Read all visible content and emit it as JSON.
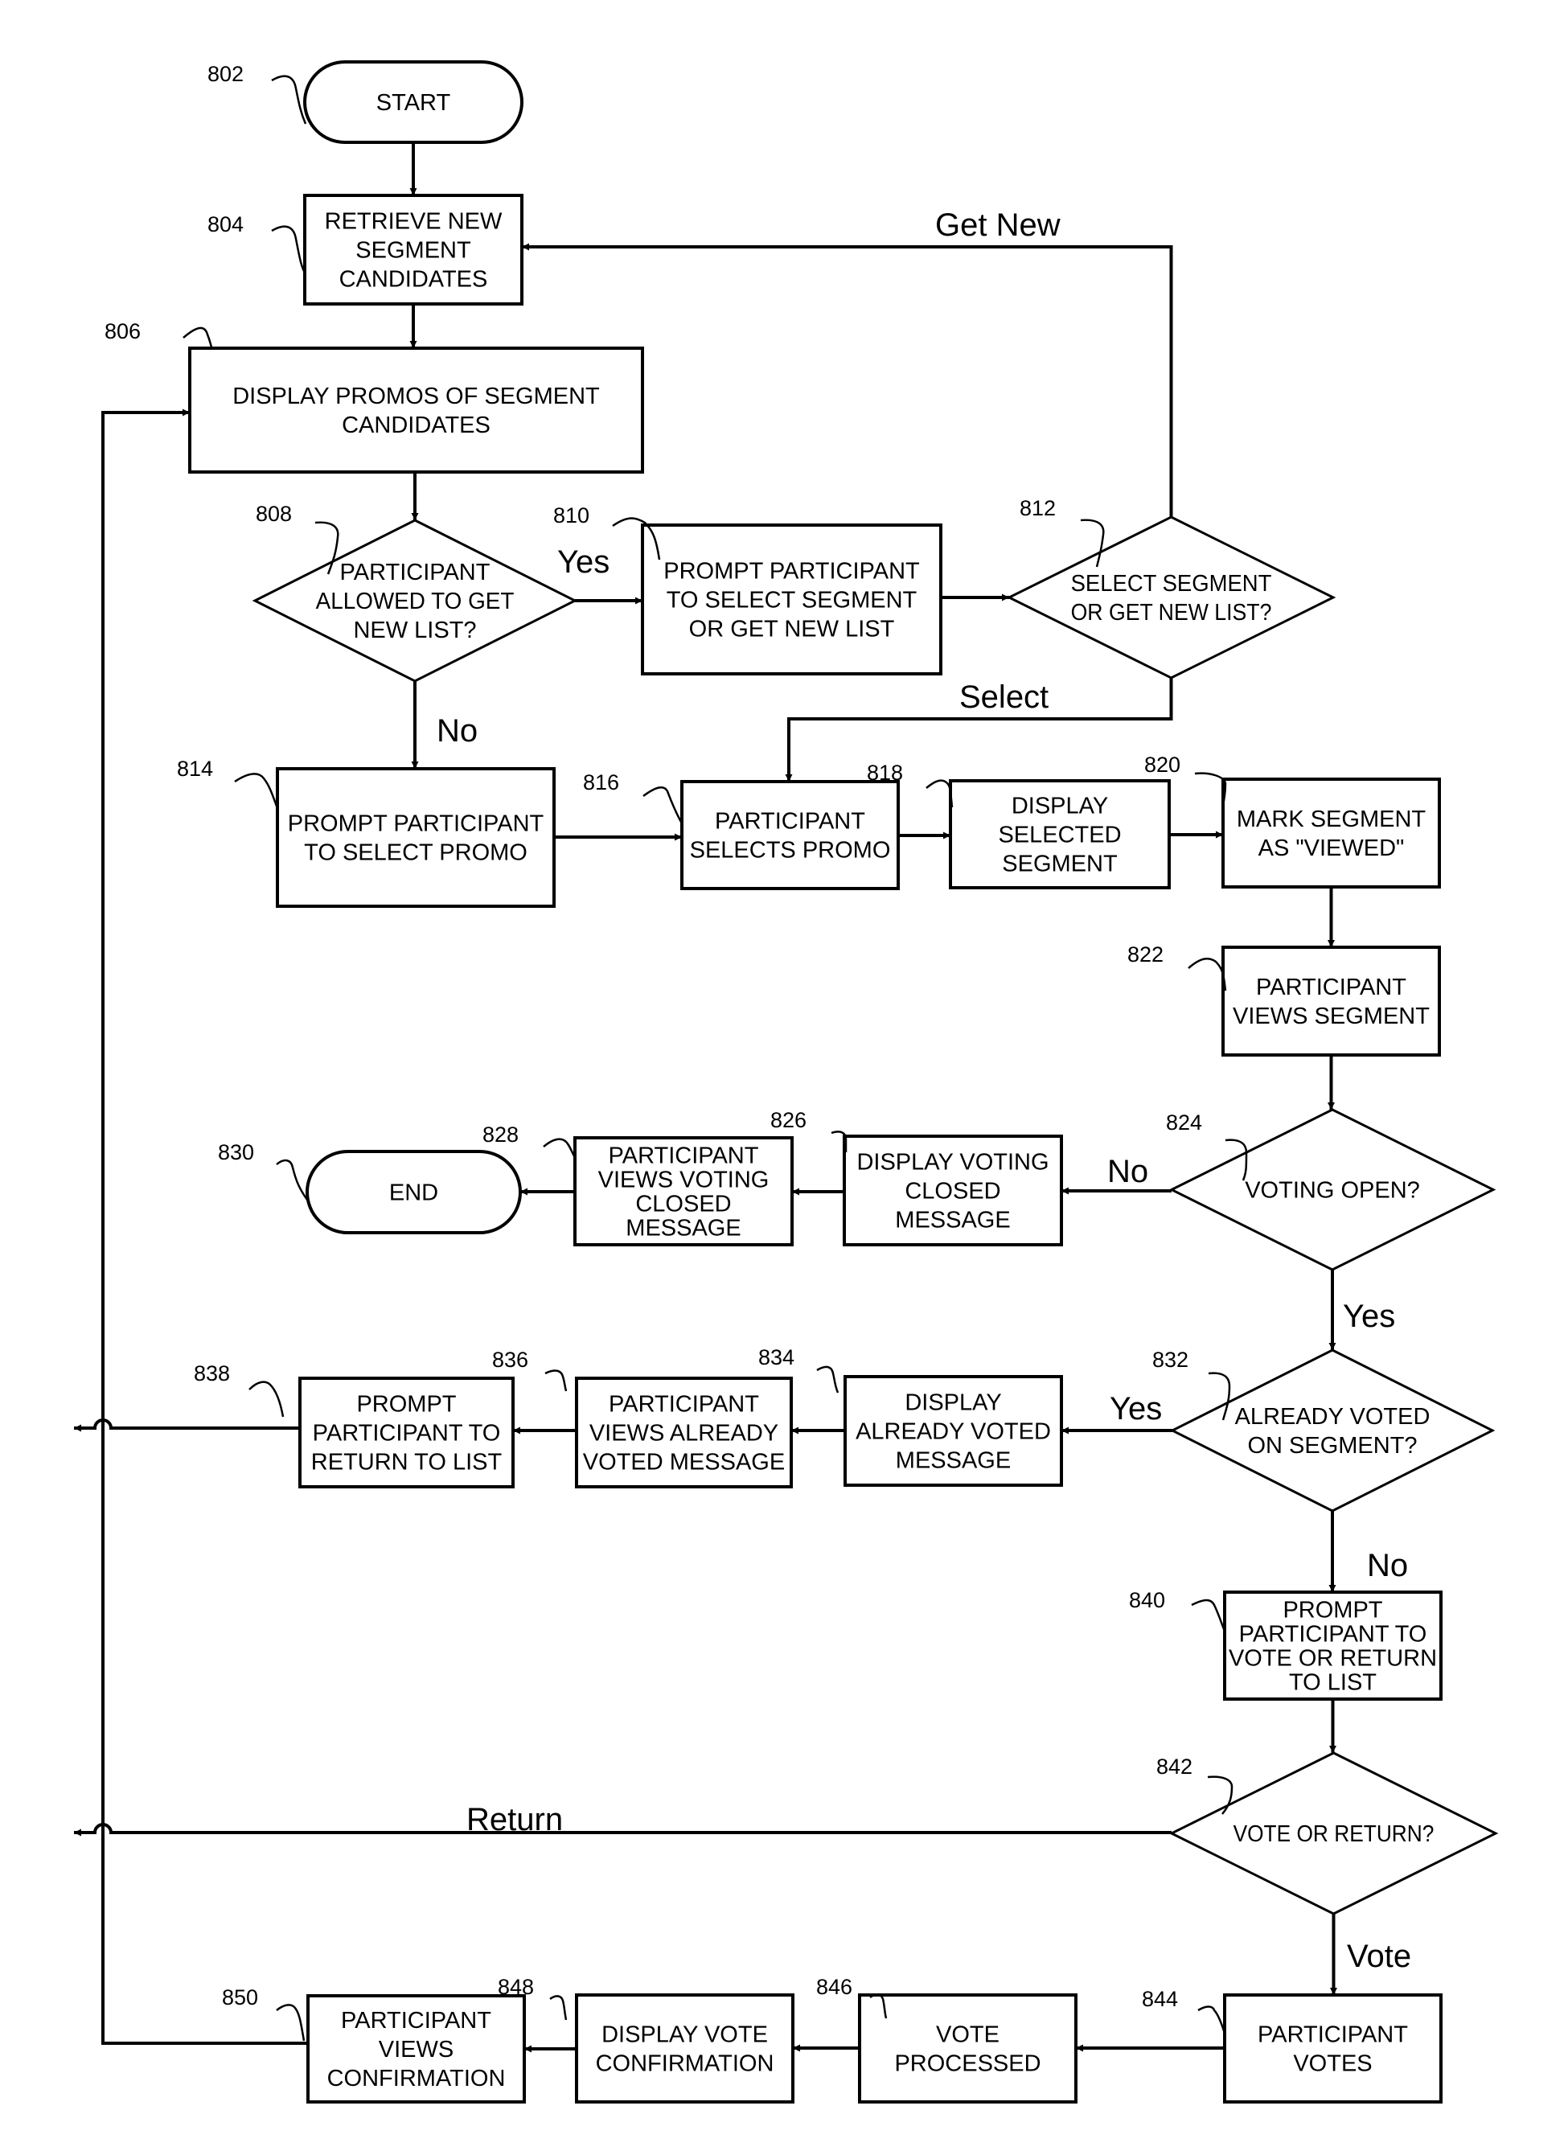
{
  "figure": {
    "type": "flowchart",
    "nodes": [
      {
        "id": "802",
        "ref": "802",
        "shape": "terminal",
        "lines": [
          "START"
        ]
      },
      {
        "id": "804",
        "ref": "804",
        "shape": "process",
        "lines": [
          "RETRIEVE NEW",
          "SEGMENT",
          "CANDIDATES"
        ]
      },
      {
        "id": "806",
        "ref": "806",
        "shape": "process",
        "lines": [
          "DISPLAY PROMOS OF SEGMENT",
          "CANDIDATES"
        ]
      },
      {
        "id": "808",
        "ref": "808",
        "shape": "decision",
        "lines": [
          "PARTICIPANT",
          "ALLOWED TO  GET",
          "NEW LIST?"
        ]
      },
      {
        "id": "810",
        "ref": "810",
        "shape": "process",
        "lines": [
          "PROMPT PARTICIPANT",
          "TO SELECT SEGMENT",
          "OR GET NEW LIST"
        ]
      },
      {
        "id": "812",
        "ref": "812",
        "shape": "decision",
        "lines": [
          "SELECT SEGMENT",
          "OR GET NEW LIST?"
        ]
      },
      {
        "id": "814",
        "ref": "814",
        "shape": "process",
        "lines": [
          "PROMPT PARTICIPANT",
          "TO SELECT PROMO"
        ]
      },
      {
        "id": "816",
        "ref": "816",
        "shape": "process",
        "lines": [
          "PARTICIPANT",
          "SELECTS PROMO"
        ]
      },
      {
        "id": "818",
        "ref": "818",
        "shape": "process",
        "lines": [
          "DISPLAY",
          "SELECTED",
          "SEGMENT"
        ]
      },
      {
        "id": "820",
        "ref": "820",
        "shape": "process",
        "lines": [
          "MARK SEGMENT",
          "AS \"VIEWED\""
        ]
      },
      {
        "id": "822",
        "ref": "822",
        "shape": "process",
        "lines": [
          "PARTICIPANT",
          "VIEWS SEGMENT"
        ]
      },
      {
        "id": "824",
        "ref": "824",
        "shape": "decision",
        "lines": [
          "VOTING OPEN?"
        ]
      },
      {
        "id": "826",
        "ref": "826",
        "shape": "process",
        "lines": [
          "DISPLAY VOTING",
          "CLOSED",
          "MESSAGE"
        ]
      },
      {
        "id": "828",
        "ref": "828",
        "shape": "process",
        "lines": [
          "PARTICIPANT",
          "VIEWS VOTING",
          "CLOSED",
          "MESSAGE"
        ]
      },
      {
        "id": "830",
        "ref": "830",
        "shape": "terminal",
        "lines": [
          "END"
        ]
      },
      {
        "id": "832",
        "ref": "832",
        "shape": "decision",
        "lines": [
          "ALREADY VOTED",
          "ON SEGMENT?"
        ]
      },
      {
        "id": "834",
        "ref": "834",
        "shape": "process",
        "lines": [
          "DISPLAY",
          "ALREADY VOTED",
          "MESSAGE"
        ]
      },
      {
        "id": "836",
        "ref": "836",
        "shape": "process",
        "lines": [
          "PARTICIPANT",
          "VIEWS ALREADY",
          "VOTED MESSAGE"
        ]
      },
      {
        "id": "838",
        "ref": "838",
        "shape": "process",
        "lines": [
          "PROMPT",
          "PARTICIPANT TO",
          "RETURN TO LIST"
        ]
      },
      {
        "id": "840",
        "ref": "840",
        "shape": "process",
        "lines": [
          "PROMPT",
          "PARTICIPANT TO",
          "VOTE OR RETURN",
          "TO LIST"
        ]
      },
      {
        "id": "842",
        "ref": "842",
        "shape": "decision",
        "lines": [
          "VOTE OR RETURN?"
        ]
      },
      {
        "id": "844",
        "ref": "844",
        "shape": "process",
        "lines": [
          "PARTICIPANT",
          "VOTES"
        ]
      },
      {
        "id": "846",
        "ref": "846",
        "shape": "process",
        "lines": [
          "VOTE",
          "PROCESSED"
        ]
      },
      {
        "id": "848",
        "ref": "848",
        "shape": "process",
        "lines": [
          "DISPLAY VOTE",
          "CONFIRMATION"
        ]
      },
      {
        "id": "850",
        "ref": "850",
        "shape": "process",
        "lines": [
          "PARTICIPANT",
          "VIEWS",
          "CONFIRMATION"
        ]
      }
    ],
    "edges": [
      {
        "from": "802",
        "to": "804",
        "label": ""
      },
      {
        "from": "804",
        "to": "806",
        "label": ""
      },
      {
        "from": "806",
        "to": "808",
        "label": ""
      },
      {
        "from": "808",
        "to": "810",
        "label": "Yes"
      },
      {
        "from": "808",
        "to": "814",
        "label": "No"
      },
      {
        "from": "810",
        "to": "812",
        "label": ""
      },
      {
        "from": "812",
        "to": "804",
        "label": "Get New"
      },
      {
        "from": "812",
        "to": "816",
        "label": "Select"
      },
      {
        "from": "814",
        "to": "816",
        "label": ""
      },
      {
        "from": "816",
        "to": "818",
        "label": ""
      },
      {
        "from": "818",
        "to": "820",
        "label": ""
      },
      {
        "from": "820",
        "to": "822",
        "label": ""
      },
      {
        "from": "822",
        "to": "824",
        "label": ""
      },
      {
        "from": "824",
        "to": "826",
        "label": "No"
      },
      {
        "from": "826",
        "to": "828",
        "label": ""
      },
      {
        "from": "828",
        "to": "830",
        "label": ""
      },
      {
        "from": "824",
        "to": "832",
        "label": "Yes"
      },
      {
        "from": "832",
        "to": "834",
        "label": "Yes"
      },
      {
        "from": "834",
        "to": "836",
        "label": ""
      },
      {
        "from": "836",
        "to": "838",
        "label": ""
      },
      {
        "from": "838",
        "to": "806",
        "label": ""
      },
      {
        "from": "832",
        "to": "840",
        "label": "No"
      },
      {
        "from": "840",
        "to": "842",
        "label": ""
      },
      {
        "from": "842",
        "to": "806",
        "label": "Return"
      },
      {
        "from": "842",
        "to": "844",
        "label": "Vote"
      },
      {
        "from": "844",
        "to": "846",
        "label": ""
      },
      {
        "from": "846",
        "to": "848",
        "label": ""
      },
      {
        "from": "848",
        "to": "850",
        "label": ""
      },
      {
        "from": "850",
        "to": "806",
        "label": ""
      }
    ]
  }
}
